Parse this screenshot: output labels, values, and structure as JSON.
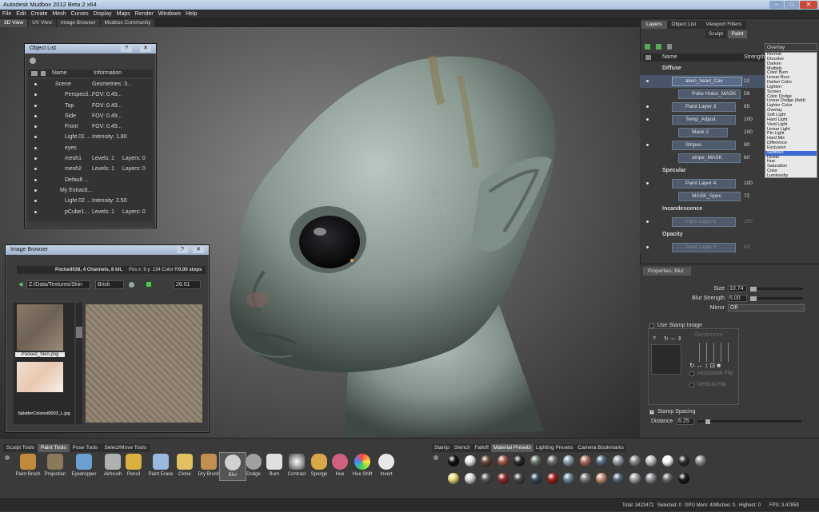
{
  "window": {
    "title": "Autodesk Mudbox 2012 Beta 2 x64"
  },
  "menu": [
    "File",
    "Edit",
    "Create",
    "Mesh",
    "Curves",
    "Display",
    "Maps",
    "Render",
    "Windows",
    "Help"
  ],
  "view_tabs": [
    "3D View",
    "UV View",
    "Image Browser",
    "Mudbox Community"
  ],
  "object_list": {
    "title": "Object List",
    "col_name": "Name",
    "col_info": "Information",
    "rows": [
      {
        "name": "Scene",
        "info": "Geometries: 3..."
      },
      {
        "name": "Perspecti...",
        "info": "FOV: 0.49..."
      },
      {
        "name": "Top",
        "info": "FOV: 0.49..."
      },
      {
        "name": "Side",
        "info": "FOV: 0.49..."
      },
      {
        "name": "Front",
        "info": "FOV: 0.49..."
      },
      {
        "name": "Light 01 ...",
        "info": "Intensity: 1.80"
      },
      {
        "name": "eyes",
        "info": ""
      },
      {
        "name": "mesh1",
        "info": "Levels: 1",
        "info2": "Layers: 0"
      },
      {
        "name": "mesh2",
        "info": "Levels: 1",
        "info2": "Layers: 0"
      },
      {
        "name": "Default ...",
        "info": ""
      },
      {
        "name": "My Extracti...",
        "info": ""
      },
      {
        "name": "Light 02 ...",
        "info": "Intensity: 2.50"
      },
      {
        "name": "pCube1...",
        "info": "Levels: 1",
        "info2": "Layers: 0"
      }
    ]
  },
  "image_browser": {
    "title": "Image Browser",
    "info": "Pocked038, 4 Channels, 8 bit,",
    "pos": "Pos x: 9 y: 134 Color R",
    "stops": "0.00 stops",
    "path": "Z:/Data/Textures/Skin",
    "brush": "Brick",
    "zoom": "26.01",
    "thumbs": [
      "Pocked_Skin.png",
      "SplatterColored0003_L.jpg"
    ]
  },
  "layers_panel": {
    "tabs": [
      "Layers",
      "Object List",
      "Viewport Filters"
    ],
    "mode_tabs": [
      "Sculpt",
      "Paint"
    ],
    "blend_selected": "Overlay",
    "col_name": "Name",
    "col_strength": "Strength",
    "groups": [
      {
        "name": "Diffuse",
        "layers": [
          {
            "name": "alien_head_Cav",
            "value": "12"
          },
          {
            "name": "Poke Holes_MASK",
            "value": "59"
          },
          {
            "name": "Paint Layer 3",
            "value": "65"
          },
          {
            "name": "Temp_Adjust",
            "value": "100"
          },
          {
            "name": "Mask 2",
            "value": "100"
          },
          {
            "name": "Stripes",
            "value": "80"
          },
          {
            "name": "stripe_MASK",
            "value": "60"
          }
        ]
      },
      {
        "name": "Specular",
        "layers": [
          {
            "name": "Paint Layer 4",
            "value": "100"
          },
          {
            "name": "MASK_Spec",
            "value": "72"
          }
        ]
      },
      {
        "name": "Incandescence",
        "layers": [
          {
            "name": "Paint Layer 6",
            "value": "100"
          }
        ]
      },
      {
        "name": "Opacity",
        "layers": [
          {
            "name": "Paint Layer 5",
            "value": "63"
          }
        ]
      }
    ],
    "blend_modes": [
      "Normal",
      "Dissolve",
      "Darken",
      "Multiply",
      "Color Burn",
      "Linear Burn",
      "Darker Color",
      "Lighten",
      "Screen",
      "Color Dodge",
      "Linear Dodge (Add)",
      "Lighter Color",
      "Overlay",
      "Soft Light",
      "Hard Light",
      "Vivid Light",
      "Linear Light",
      "Pin Light",
      "Hard Mix",
      "Difference",
      "Exclusion",
      "Subtract",
      "Divide",
      "Hue",
      "Saturation",
      "Color",
      "Luminosity"
    ],
    "blend_highlight": "Subtract"
  },
  "properties": {
    "title": "Properties: Blur",
    "size_label": "Size",
    "size": "10.74",
    "strength_label": "Blur Strength",
    "strength": "6.00",
    "mirror_label": "Mirror",
    "mirror": "Off",
    "use_stamp": "Use Stamp Image",
    "randomize": "Randomize",
    "hflip": "Horizontal Flip",
    "vflip": "Vertical Flip",
    "stamp_spacing": "Stamp Spacing",
    "distance_label": "Distance",
    "distance": "6.25"
  },
  "tool_tabs": [
    "Sculpt Tools",
    "Paint Tools",
    "Pose Tools",
    "Select/Move Tools"
  ],
  "tools": [
    {
      "label": "Paint Brush",
      "color": "#c08a3a"
    },
    {
      "label": "Projection",
      "color": "#8a7a5a"
    },
    {
      "label": "Eyedropper",
      "color": "#6aa0d0"
    },
    {
      "label": "Airbrush",
      "color": "#b0b0b0"
    },
    {
      "label": "Pencil",
      "color": "#d8b040"
    },
    {
      "label": "Paint Erase",
      "color": "#9ab8e0"
    },
    {
      "label": "Clone",
      "color": "#e0c060"
    },
    {
      "label": "Dry Brush",
      "color": "#c09050"
    },
    {
      "label": "Blur",
      "color": "#d0d0d0"
    },
    {
      "label": "Dodge",
      "color": "#a0a0a0"
    },
    {
      "label": "Burn",
      "color": "#e0e0e0"
    },
    {
      "label": "Contrast",
      "color": "#ffffff"
    },
    {
      "label": "Sponge",
      "color": "#d8a848"
    },
    {
      "label": "Hue",
      "color": "#d06080"
    },
    {
      "label": "Hue Shift",
      "color": "#4080d0"
    },
    {
      "label": "Invert",
      "color": "#e8e8e8"
    }
  ],
  "tray_tabs": [
    "Stamp",
    "Stencil",
    "Falloff",
    "Material Presets",
    "Lighting Presets",
    "Camera Bookmarks"
  ],
  "materials_row1": [
    "#111111",
    "#e8e8e8",
    "#6a4a3a",
    "#a05a4a",
    "#2a2a2a",
    "#6a7a6a",
    "#707070",
    "#8aa0b0",
    "#b07060",
    "#5a7080",
    "#9aa0a8",
    "#8a8a8a",
    "#c0c0c0",
    "#ffffff",
    "#303030",
    "#909090"
  ],
  "materials_row2": [
    "#e8d878",
    "#d8d8d8",
    "#5a5a5a",
    "#8a3030",
    "#4a4a4a",
    "#3a4a60",
    "#a02020",
    "#6a8a9a",
    "#7a7a7a",
    "#c09070",
    "#5a6a7a",
    "#a0a0a0",
    "#909098",
    "#6a6a6a",
    "#1a1a1a"
  ],
  "status": {
    "total": "Total: 3423472",
    "selected": "Selected: 0",
    "gpu": "GPU Mem: 409",
    "active": "Active: 0,",
    "highest": "Highest: 0",
    "fps": "FPS: 3.47859"
  }
}
